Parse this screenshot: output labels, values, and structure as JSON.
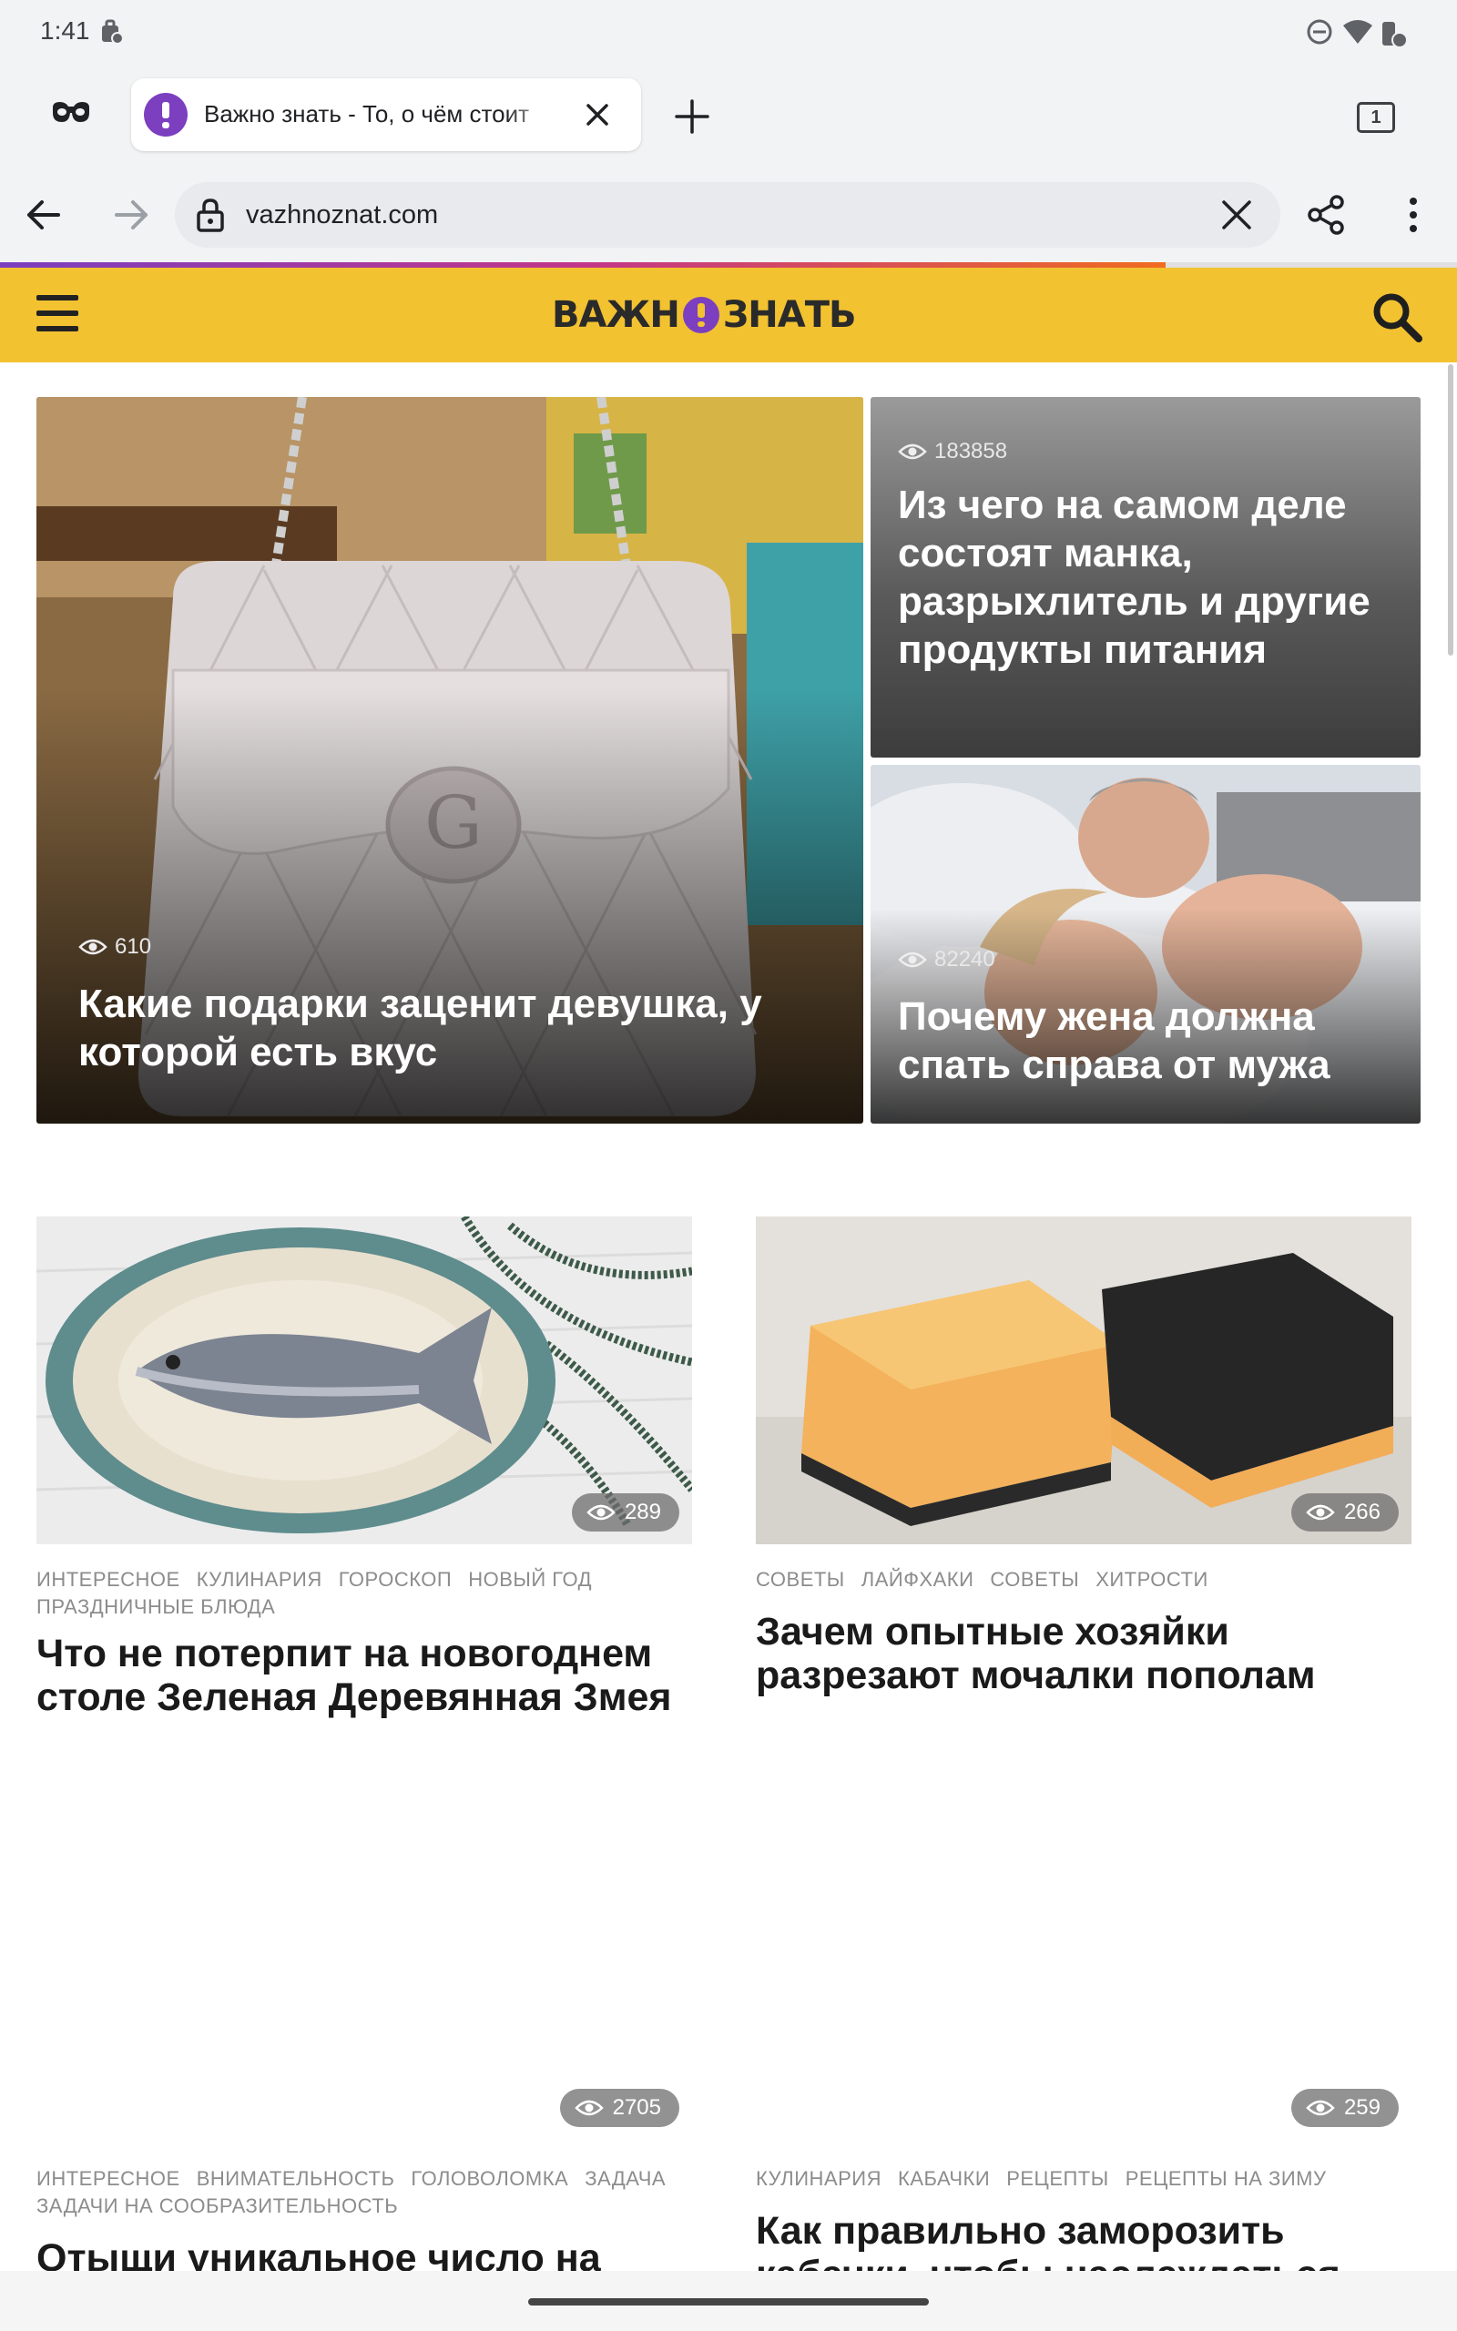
{
  "status": {
    "time": "1:41"
  },
  "tab": {
    "title": "Важно знать - То, о чём стоит",
    "count": "1"
  },
  "omnibox": {
    "url": "vazhnoznat.com"
  },
  "page_load_progress": 0.8,
  "site": {
    "logo_left": "ВАЖН",
    "logo_right": "ЗНАТЬ"
  },
  "colors": {
    "header": "#f2c231",
    "brand_purple": "#7b3fbf"
  },
  "hero": [
    {
      "views": "610",
      "title": "Какие подарки заценит девушка, у которой есть вкус"
    },
    {
      "views": "183858",
      "title": "Из чего на самом деле состоят манка, разрыхлитель и другие продукты питания"
    },
    {
      "views": "82240",
      "title": "Почему жена должна спать справа от мужа"
    }
  ],
  "articles": [
    {
      "views": "289",
      "tags": [
        "ИНТЕРЕСНОЕ",
        "КУЛИНАРИЯ",
        "ГОРОСКОП",
        "НОВЫЙ ГОД",
        "ПРАЗДНИЧНЫЕ БЛЮДА"
      ],
      "title": "Что не потерпит на новогоднем столе Зеленая Деревянная Змея"
    },
    {
      "views": "266",
      "tags": [
        "СОВЕТЫ",
        "ЛАЙФХАКИ",
        "СОВЕТЫ",
        "ХИТРОСТИ"
      ],
      "title": "Зачем опытные хозяйки разрезают мочалки пополам"
    },
    {
      "views": "2705",
      "tags": [
        "ИНТЕРЕСНОЕ",
        "ВНИМАТЕЛЬНОСТЬ",
        "ГОЛОВОЛОМКА",
        "ЗАДАЧА",
        "ЗАДАЧИ НА СООБРАЗИТЕЛЬНОСТЬ"
      ],
      "title": "Отыщи уникальное число на"
    },
    {
      "views": "259",
      "tags": [
        "КУЛИНАРИЯ",
        "КАБАЧКИ",
        "РЕЦЕПТЫ",
        "РЕЦЕПТЫ НА ЗИМУ"
      ],
      "title": "Как правильно заморозить кабачки, чтобы наслаждаться"
    }
  ]
}
